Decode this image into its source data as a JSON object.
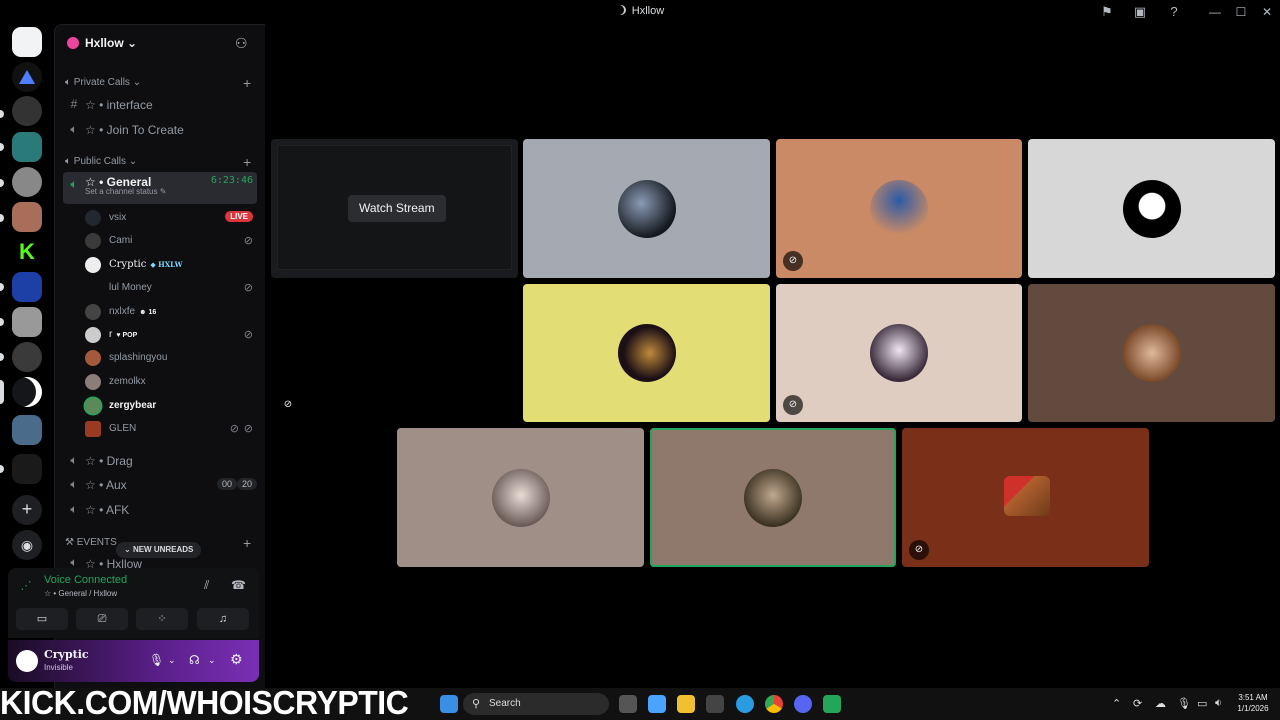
{
  "window": {
    "title": "Hxllow"
  },
  "guild": {
    "name": "Hxllow"
  },
  "sidebar": {
    "categories": [
      {
        "name": "Private Calls"
      },
      {
        "name": "Public Calls"
      },
      {
        "name": "EVENTS"
      }
    ],
    "channels": {
      "interface": "☆ • interface",
      "join_to_create": "☆ • Join To Create",
      "general": "☆ • General",
      "general_timer": "6:23:46",
      "general_status": "Set a channel status",
      "drag": "☆ • Drag",
      "aux": "☆ • Aux",
      "aux_badge_left": "00",
      "aux_badge_right": "20",
      "afk": "☆ • AFK",
      "hxllow": "☆ • Hxllow"
    },
    "voice_users": [
      {
        "name": "vsix",
        "live": "LIVE"
      },
      {
        "name": "Cami"
      },
      {
        "name": "Cryptic",
        "tag": "HXLW"
      },
      {
        "name": "lul Money"
      },
      {
        "name": "nxlxfe",
        "tag": "16"
      },
      {
        "name": "r",
        "tag": "POP"
      },
      {
        "name": "splashingyou"
      },
      {
        "name": "zemolkx"
      },
      {
        "name": "zergybear"
      },
      {
        "name": "GLEN"
      }
    ],
    "new_unreads": "NEW UNREADS"
  },
  "voice_panel": {
    "status": "Voice Connected",
    "location": "☆ • General / Hxllow"
  },
  "user_panel": {
    "name": "Cryptic",
    "status": "Invisible"
  },
  "stage": {
    "watch_stream": "Watch Stream"
  },
  "overlay": {
    "text": "KICK.COM/WHOISCRYPTIC"
  },
  "taskbar": {
    "search_placeholder": "Search",
    "time": "3:51 AM",
    "date": "1/1/2026"
  },
  "colors": {
    "accent_green": "#23a55a",
    "live_red": "#da373c",
    "tile_slate": "#a4a9b2",
    "tile_peach": "#c98a65",
    "tile_grey": "#d7d7d7",
    "tile_yellow": "#e2dd74",
    "tile_cream": "#dfcdc1",
    "tile_brown": "#634a3f",
    "tile_taupe": "#a08f87",
    "tile_mocha": "#8e796c",
    "tile_rust": "#7a2f18"
  }
}
